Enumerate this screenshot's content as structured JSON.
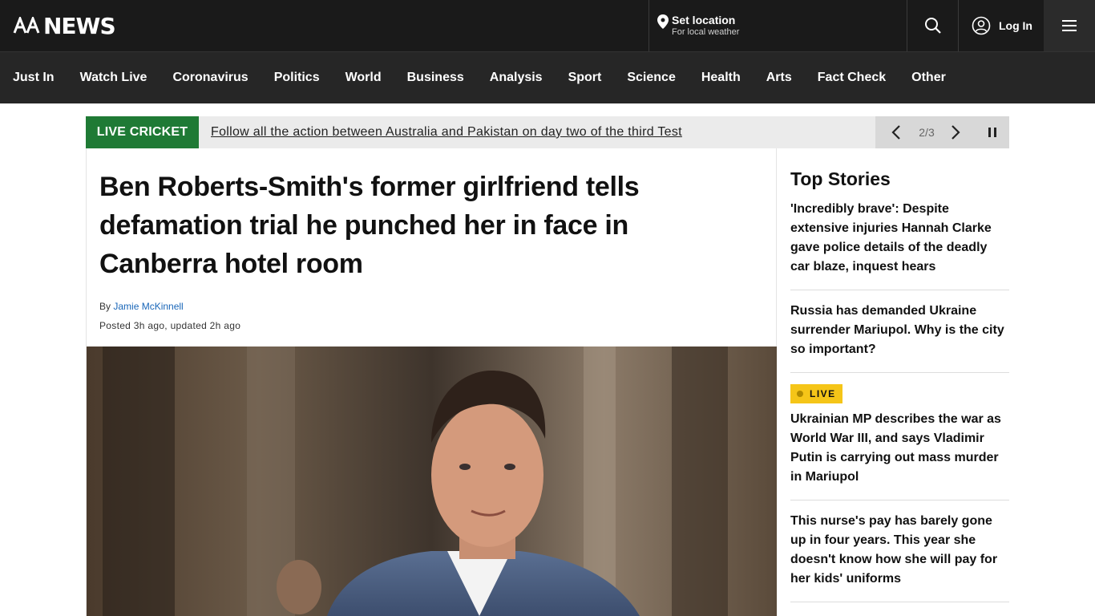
{
  "header": {
    "logo_text": "NEWS",
    "location": {
      "title": "Set location",
      "subtitle": "For local weather"
    },
    "login_label": "Log In"
  },
  "nav": {
    "items": [
      "Just In",
      "Watch Live",
      "Coronavirus",
      "Politics",
      "World",
      "Business",
      "Analysis",
      "Sport",
      "Science",
      "Health",
      "Arts",
      "Fact Check",
      "Other"
    ]
  },
  "banner": {
    "tag": "LIVE CRICKET",
    "text": "Follow all the action between Australia and Pakistan on day two of the third Test",
    "count": "2/3"
  },
  "article": {
    "headline": "Ben Roberts-Smith's former girlfriend tells defamation trial he punched her in face in Canberra hotel room",
    "by_prefix": "By",
    "author": "Jamie McKinnell",
    "posted": "Posted 3h ago, updated 2h ago"
  },
  "sidebar": {
    "title": "Top Stories",
    "live_label": "LIVE",
    "stories": [
      "'Incredibly brave': Despite extensive injuries Hannah Clarke gave police details of the deadly car blaze, inquest hears",
      "Russia has demanded Ukraine surrender Mariupol. Why is the city so important?",
      "Ukrainian MP describes the war as World War III, and says Vladimir Putin is carrying out mass murder in Mariupol",
      "This nurse's pay has barely gone up in four years. This year she doesn't know how she will pay for her kids' uniforms"
    ]
  },
  "colors": {
    "topbar": "#1a1a1a",
    "navbar": "#262626",
    "live_cricket": "#1f7a35",
    "live_badge": "#f5c518",
    "author_link": "#1966b8"
  }
}
